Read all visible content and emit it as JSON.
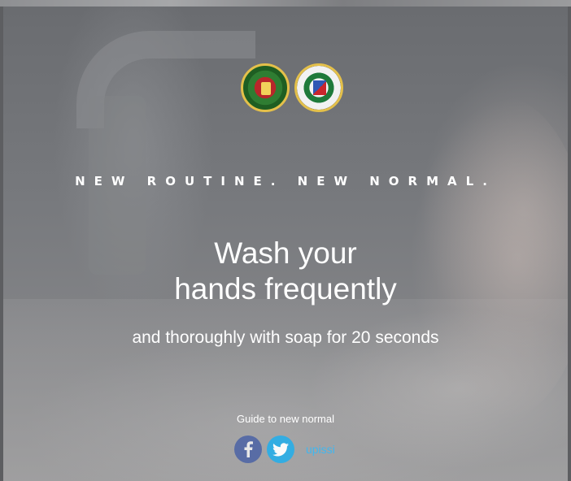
{
  "poster": {
    "tagline": "NEW ROUTINE. NEW NORMAL.",
    "headline_line1": "Wash your",
    "headline_line2": "hands frequently",
    "subline": "and thoroughly with soap for 20 seconds",
    "guide_text": "Guide to new normal",
    "social_handle": "upissi"
  },
  "icons": {
    "logo_left": "university-seal-icon",
    "logo_right": "college-seal-icon",
    "facebook": "facebook-icon",
    "twitter": "twitter-icon"
  },
  "colors": {
    "text": "#ffffff",
    "handle": "#3fb7f0",
    "facebook": "#3f5aa6",
    "twitter": "#2eaee6"
  }
}
